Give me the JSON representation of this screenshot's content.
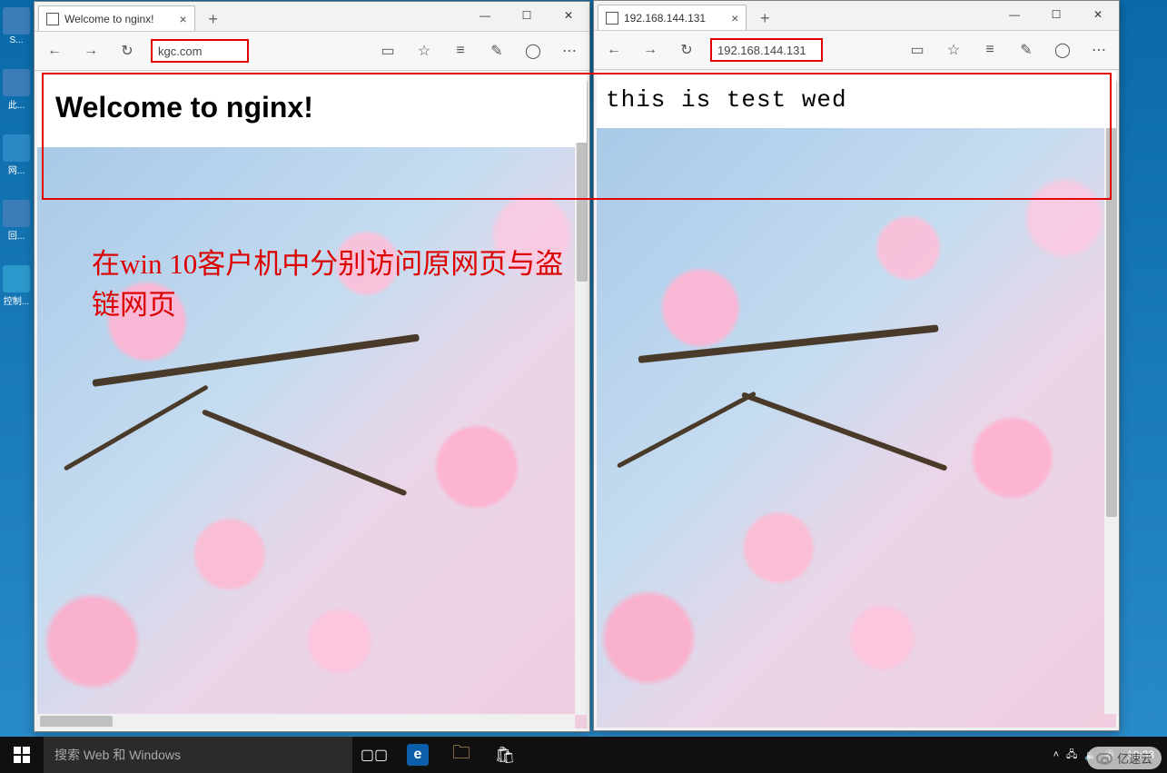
{
  "desktop_icons": [
    "S...",
    "此...",
    "网...",
    "回...",
    "控制..."
  ],
  "browser1": {
    "tab_title": "Welcome to nginx!",
    "url": "kgc.com",
    "heading": "Welcome to nginx!"
  },
  "browser2": {
    "tab_title": "192.168.144.131",
    "url": "192.168.144.131",
    "body_text": "this is test wed"
  },
  "annotation": "在win 10客户机中分别访问原网页与盗链网页",
  "taskbar": {
    "search_placeholder": "搜索 Web 和 Windows",
    "clock": "19:33"
  },
  "watermark": "亿速云",
  "window_buttons": {
    "min": "—",
    "max": "☐",
    "close": "✕"
  },
  "nav_icons": {
    "back": "←",
    "fwd": "→",
    "refresh": "↻",
    "read": "▭",
    "fav": "☆",
    "hub": "≡",
    "note": "✎",
    "share": "◯",
    "more": "⋯"
  },
  "tab_close": "×",
  "tab_new": "+"
}
